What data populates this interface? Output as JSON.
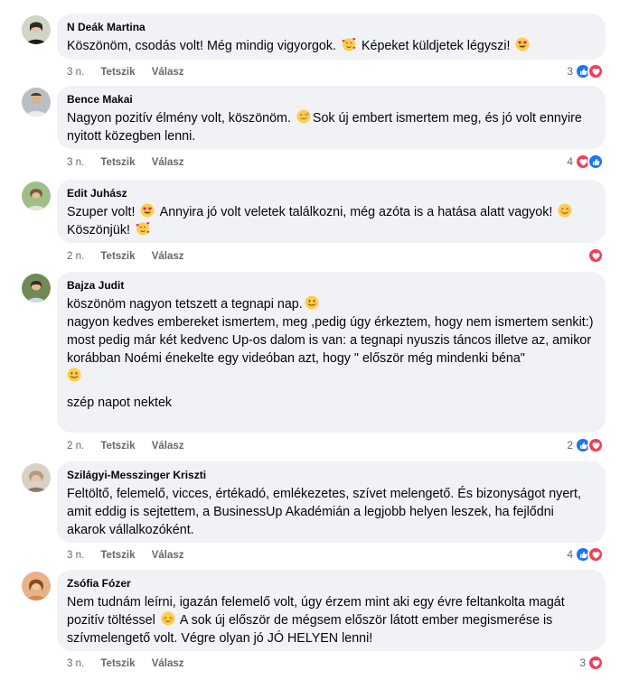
{
  "comments": [
    {
      "author": "N Deák Martina",
      "paragraphs": [
        "Köszönöm, csodás volt! Még mindig vigyorgok."
      ],
      "tail_after_emoji1": " Képeket küldjetek légyszi!",
      "time": "3 n.",
      "like_label": "Tetszik",
      "reply_label": "Válasz",
      "reaction_count": "3",
      "reactions": [
        "like",
        "love"
      ]
    },
    {
      "author": "Bence Makai",
      "text_a": "Nagyon pozitív élmény volt, köszönöm.",
      "text_b": "Sok új embert ismertem meg, és jó volt ennyire nyitott közegben lenni.",
      "time": "3 n.",
      "like_label": "Tetszik",
      "reply_label": "Válasz",
      "reaction_count": "4",
      "reactions": [
        "love",
        "like"
      ]
    },
    {
      "author": "Edit Juhász",
      "text_a": "Szuper volt!",
      "text_b": " Annyira jó volt veletek találkozni, még azóta is a hatása alatt vagyok!",
      "text_c": "Köszönjük!",
      "time": "2 n.",
      "like_label": "Tetszik",
      "reply_label": "Válasz",
      "reaction_count": "",
      "reactions": [
        "love"
      ]
    },
    {
      "author": "Bajza Judit",
      "line1": "köszönöm nagyon tetszett a tegnapi nap.",
      "line2": "nagyon kedves embereket ismertem, meg ,pedig úgy érkeztem, hogy nem ismertem senkit:)",
      "line3": "most pedig már két kedvenc Up-os dalom is van: a tegnapi nyuszis táncos illetve az, amikor korábban Noémi énekelte egy videóban azt, hogy \" először még mindenki béna\"",
      "line4": "szép napot nektek",
      "time": "2 n.",
      "like_label": "Tetszik",
      "reply_label": "Válasz",
      "reaction_count": "2",
      "reactions": [
        "like",
        "love"
      ]
    },
    {
      "author": "Szilágyi-Messzinger Kriszti",
      "text": "Feltöltő, felemelő, vicces, értékadó, emlékezetes, szívet melengető. És bizonyságot nyert, amit eddig is sejtettem, a BusinessUp Akadémián a legjobb helyen leszek, ha fejlődni akarok vállalkozóként.",
      "time": "3 n.",
      "like_label": "Tetszik",
      "reply_label": "Válasz",
      "reaction_count": "4",
      "reactions": [
        "like",
        "love"
      ]
    },
    {
      "author": "Zsófia Fózer",
      "text_a": "Nem tudnám leírni, igazán felemelő volt, úgy érzem mint aki egy évre feltankolta magát pozitív töltéssel",
      "text_b": " A sok új először de mégsem először látott ember megismerése is szívmelengető volt. Végre olyan jó JÓ HELYEN lenni!",
      "time": "3 n.",
      "like_label": "Tetszik",
      "reply_label": "Válasz",
      "reaction_count": "3",
      "reactions": [
        "love"
      ]
    }
  ],
  "colors": {
    "bubble": "#f0f2f5",
    "meta_text": "#65676b",
    "like_blue": "#1877f2",
    "love_red": "#f33e58"
  }
}
